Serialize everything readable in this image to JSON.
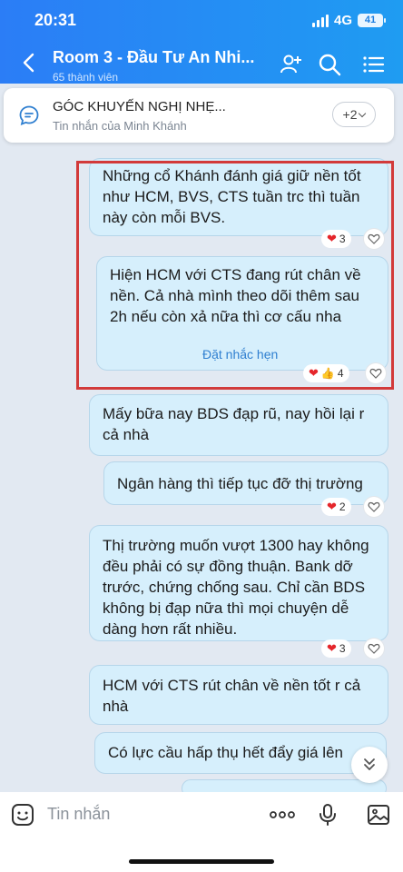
{
  "status": {
    "time": "20:31",
    "network": "4G",
    "battery": "41"
  },
  "header": {
    "title": "Room 3 - Đầu Tư An Nhi...",
    "members": "65 thành viên"
  },
  "pinned": {
    "title": "GÓC KHUYẾN NGHỊ NHẸ...",
    "subtitle": "Tin nhắn của Minh Khánh",
    "more": "+2"
  },
  "messages": [
    {
      "text": "Những cổ Khánh đánh giá giữ nền tốt như HCM, BVS, CTS tuần trc thì tuần này còn mỗi BVS.",
      "reaction_count": "3"
    },
    {
      "text": "Hiện HCM với CTS đang rút chân về nền. Cả nhà mình theo dõi thêm sau 2h nếu còn xả nữa thì cơ cấu nha",
      "action": "Đặt nhắc hẹn",
      "reaction_count": "4"
    },
    {
      "text": "Mấy bữa nay BDS đạp rũ, nay hồi lại r cả nhà"
    },
    {
      "text": "Ngân hàng thì tiếp tục đỡ thị trường",
      "reaction_count": "2"
    },
    {
      "text": "Thị trường muốn vượt 1300 hay không đều phải có sự đồng thuận. Bank dỡ trước, chứng chống sau. Chỉ cần BDS không bị đạp nữa thì mọi chuyện dễ dàng hơn rất nhiều.",
      "reaction_count": "3"
    },
    {
      "text": "HCM với CTS rút chân về nền tốt r cả nhà"
    },
    {
      "text": "Có lực cầu hấp thụ hết đẩy giá lên"
    }
  ],
  "input": {
    "placeholder": "Tin nhắn"
  },
  "icons": {
    "back": "chevron-left-icon",
    "add_member": "add-member-icon",
    "search": "search-icon",
    "menu": "list-menu-icon",
    "pinned": "chat-bubble-icon",
    "sticker": "sticker-smile-icon",
    "more": "more-dots-icon",
    "mic": "microphone-icon",
    "image": "image-icon",
    "scroll": "chevron-down-double-icon"
  },
  "colors": {
    "header": "#2b7df6",
    "bubble": "#d6effc",
    "highlight": "#d23a3a",
    "heart": "#e5262b",
    "link": "#2f7fd0"
  }
}
